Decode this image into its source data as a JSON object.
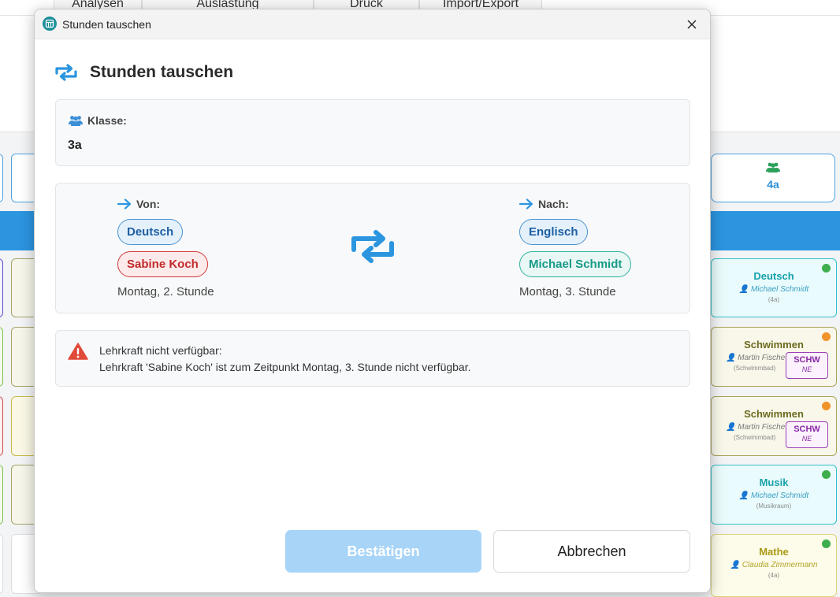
{
  "background": {
    "tabs": [
      "Analysen",
      "Auslastung",
      "Druck",
      "Import/Export"
    ],
    "class_header": "4a",
    "cells": [
      {
        "subject": "Deutsch",
        "teacher": "Michael Schmidt",
        "room": "(4a)"
      },
      {
        "subject": "Schwimmen",
        "teacher": "Martin Fische",
        "room": "(Schwimmbad)",
        "tag": "SCHW",
        "tag_sub": "NE"
      },
      {
        "subject": "Schwimmen",
        "teacher": "Martin Fische",
        "room": "(Schwimmbad)",
        "tag": "SCHW",
        "tag_sub": "NE"
      },
      {
        "subject": "Musik",
        "teacher": "Michael Schmidt",
        "room": "(Musikraum)"
      },
      {
        "subject": "Mathe",
        "teacher": "Claudia Zimmermann",
        "room": "(4a)"
      }
    ]
  },
  "dialog": {
    "window_title": "Stunden tauschen",
    "heading": "Stunden tauschen",
    "class_label": "Klasse:",
    "class_value": "3a",
    "from": {
      "label": "Von:",
      "subject": "Deutsch",
      "teacher": "Sabine Koch",
      "slot": "Montag, 2. Stunde"
    },
    "to": {
      "label": "Nach:",
      "subject": "Englisch",
      "teacher": "Michael Schmidt",
      "slot": "Montag, 3. Stunde"
    },
    "warning": {
      "title": "Lehrkraft nicht verfügbar:",
      "message": "Lehrkraft 'Sabine Koch' ist zum Zeitpunkt Montag, 3. Stunde nicht verfügbar."
    },
    "confirm_label": "Bestätigen",
    "cancel_label": "Abbrechen"
  },
  "colors": {
    "accent": "#2b95e0",
    "confirm_disabled": "#a8d4f8",
    "warning_red": "#e04a3a"
  }
}
